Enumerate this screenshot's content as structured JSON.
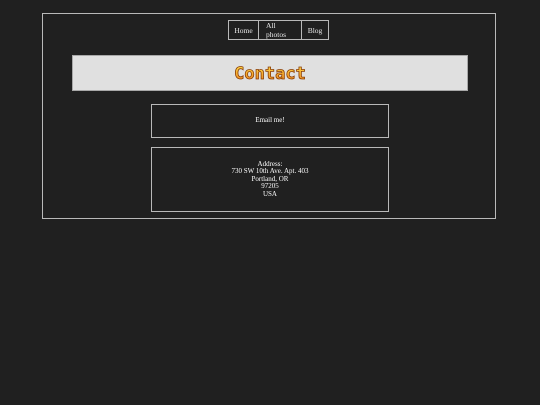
{
  "nav": {
    "items": [
      {
        "label": "Home"
      },
      {
        "label": "All photos"
      },
      {
        "label": "Blog"
      }
    ]
  },
  "banner": {
    "title": "Contact",
    "colors": {
      "background": "#e0e0e0",
      "letters_top": "#ffe14a",
      "letters_bottom": "#e9761a",
      "outline": "#8a3c00"
    }
  },
  "contact": {
    "email_label": "Email me!",
    "address_lines": [
      "Address:",
      "730 SW 10th Ave. Apt. 403",
      "Portland, OR",
      "97205",
      "USA"
    ]
  },
  "colors": {
    "page_background": "#202020",
    "border": "#b9b9b9",
    "text": "#ffffff"
  }
}
